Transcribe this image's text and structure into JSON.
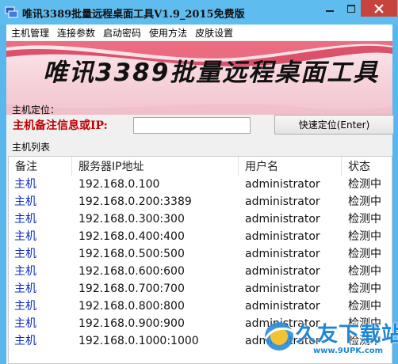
{
  "window": {
    "title": "唯讯3389批量远程桌面工具V1.9_2015免费版"
  },
  "menu": [
    "主机管理",
    "连接参数",
    "启动密码",
    "使用方法",
    "皮肤设置"
  ],
  "banner": {
    "text": "唯讯3389批量远程桌面工具"
  },
  "locate": {
    "group_label": "主机定位：",
    "field_label": "主机备注信息或IP:",
    "input_value": "",
    "button_label": "快速定位(Enter)"
  },
  "host_list": {
    "group_label": "主机列表",
    "columns": [
      "备注",
      "服务器IP地址",
      "用户名",
      "状态"
    ],
    "rows": [
      {
        "note": "主机",
        "ip": "192.168.0.100",
        "user": "administrator",
        "status": "检测中"
      },
      {
        "note": "主机",
        "ip": "192.168.0.200:3389",
        "user": "administrator",
        "status": "检测中"
      },
      {
        "note": "主机",
        "ip": "192.168.0.300:300",
        "user": "administrator",
        "status": "检测中"
      },
      {
        "note": "主机",
        "ip": "192.168.0.400:400",
        "user": "administrator",
        "status": "检测中"
      },
      {
        "note": "主机",
        "ip": "192.168.0.500:500",
        "user": "administrator",
        "status": "检测中"
      },
      {
        "note": "主机",
        "ip": "192.168.0.600:600",
        "user": "administrator",
        "status": "检测中"
      },
      {
        "note": "主机",
        "ip": "192.168.0.700:700",
        "user": "administrator",
        "status": "检测中"
      },
      {
        "note": "主机",
        "ip": "192.168.0.800:800",
        "user": "administrator",
        "status": "检测中"
      },
      {
        "note": "主机",
        "ip": "192.168.0.900:900",
        "user": "administrator",
        "status": "检测中"
      },
      {
        "note": "主机",
        "ip": "192.168.0.1000:1000",
        "user": "administrator",
        "status": "检测中"
      }
    ]
  },
  "watermark": {
    "text": "久友下载站",
    "url": "www.9UPK.com"
  },
  "icons": [
    "app-icon",
    "minimize-icon",
    "maximize-icon",
    "close-icon"
  ],
  "colors": {
    "title_bar": "#5fbcef",
    "close_button": "#c7443d",
    "locate_label": "#c00000",
    "note_text": "#0c2cc4",
    "watermark": "#1e86d6"
  }
}
